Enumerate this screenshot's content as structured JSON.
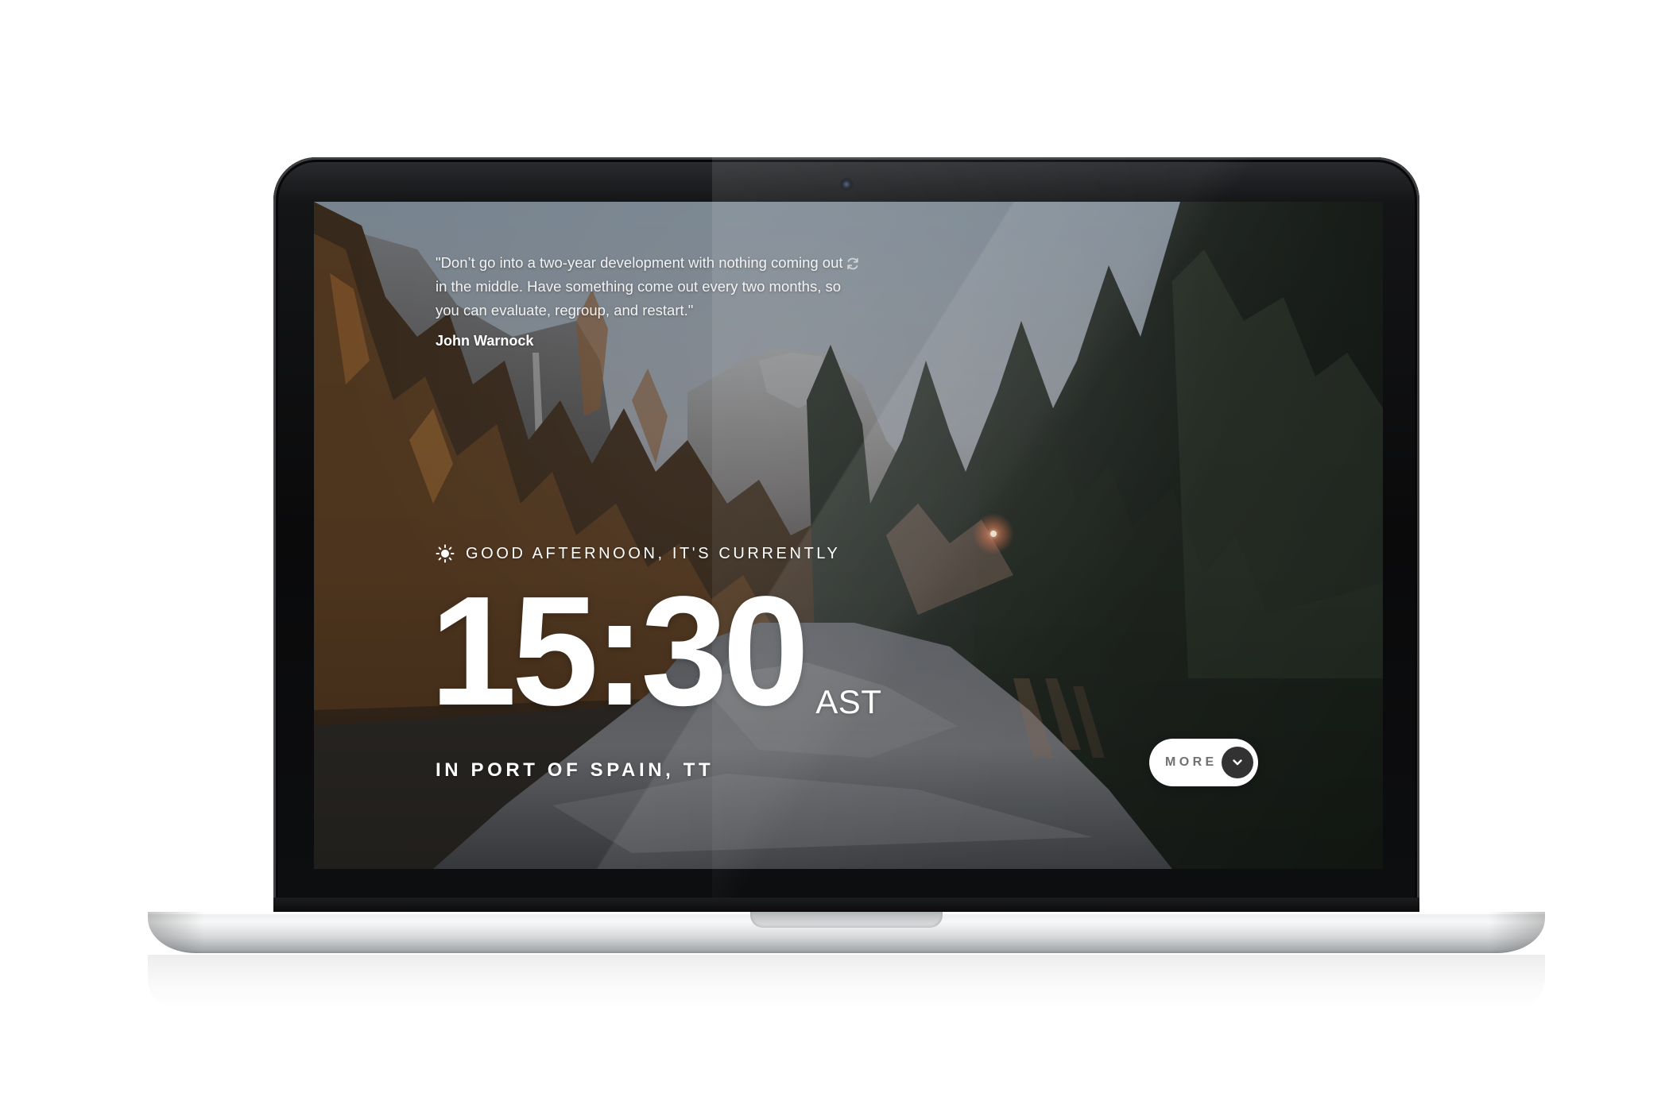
{
  "quote": {
    "text": "\"Don’t go into a two-year development with nothing coming out in the middle. Have something come out every two months, so you can evaluate, regroup, and restart.\"",
    "author": "John Warnock"
  },
  "greeting": {
    "text": "GOOD AFTERNOON, IT'S CURRENTLY",
    "icon": "sun-icon"
  },
  "clock": {
    "time": "15:30",
    "timezone": "AST"
  },
  "location": "IN PORT OF SPAIN, TT",
  "more_button": {
    "label": "MORE",
    "icon": "chevron-down-icon"
  },
  "colors": {
    "text": "#ffffff",
    "button_bg": "#ffffff",
    "button_text": "#6e6e6e",
    "chevron_bg": "#2f2f2f"
  }
}
